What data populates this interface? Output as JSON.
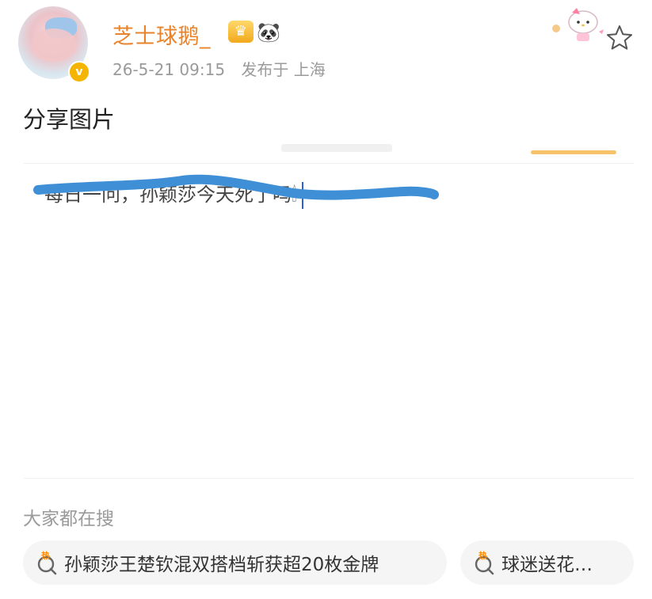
{
  "post": {
    "author": "芝士球鹅_",
    "timestamp": "26-5-21 09:15",
    "location": "发布于 上海",
    "text": "分享图片",
    "quoted_text": "每日一问，孙颖莎今天死了吗"
  },
  "search": {
    "section_title": "大家都在搜",
    "hot_tag": "热",
    "items": [
      {
        "label": "孙颖莎王楚钦混双搭档斩获超20枚金牌"
      },
      {
        "label": "球迷送花…"
      }
    ]
  },
  "colors": {
    "username": "#e9832b",
    "meta": "#9a9a9a",
    "scribble": "#3f8fd6",
    "verified": "#f5b400"
  }
}
